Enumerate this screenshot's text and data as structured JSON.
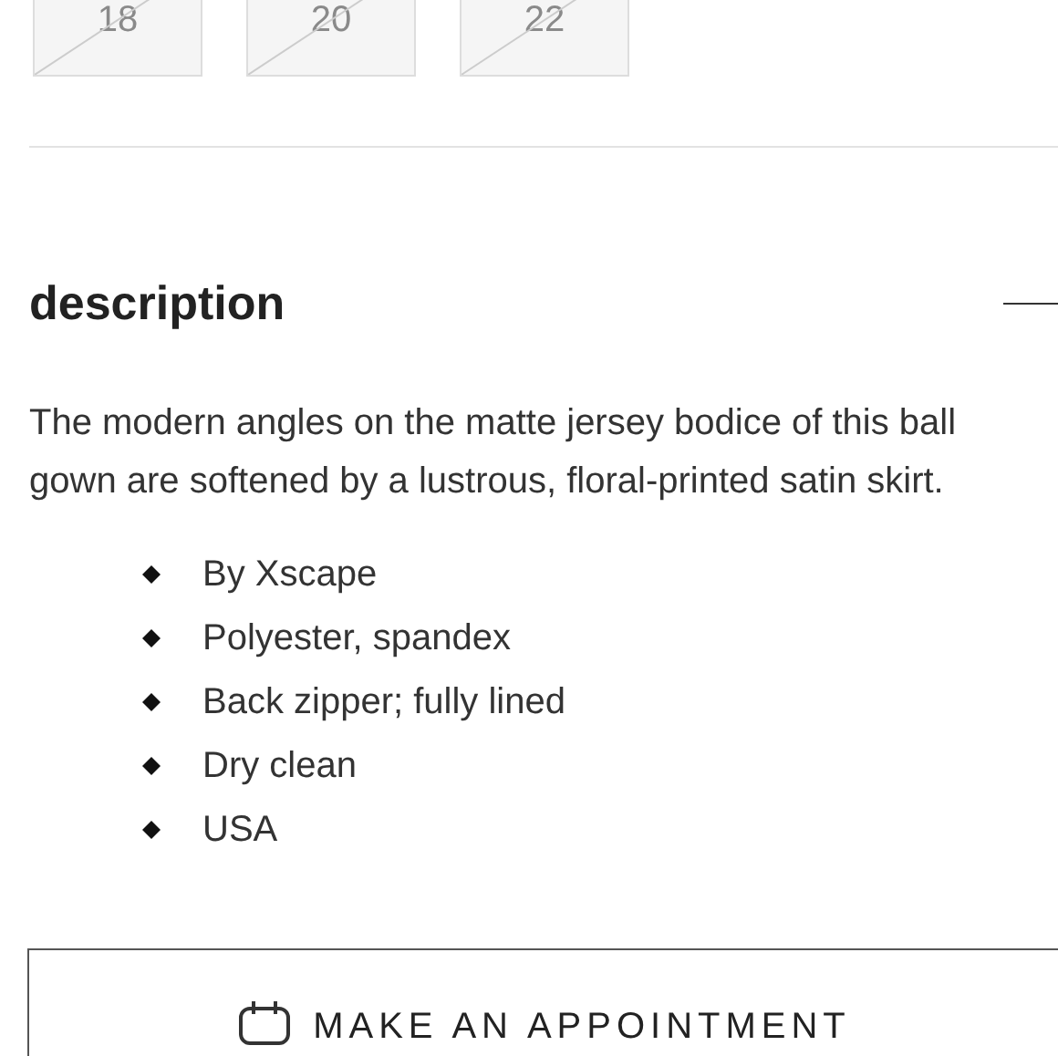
{
  "sizes": [
    {
      "label": "18",
      "available": false
    },
    {
      "label": "20",
      "available": false
    },
    {
      "label": "22",
      "available": false
    }
  ],
  "description": {
    "title": "description",
    "expanded": true,
    "text": "The modern angles on the matte jersey bodice of this ball gown are softened by a lustrous, floral-printed satin skirt.",
    "bullets": [
      "By Xscape",
      "Polyester, spandex",
      "Back zipper; fully lined",
      "Dry clean",
      "USA"
    ]
  },
  "appointment_button": "MAKE AN APPOINTMENT"
}
